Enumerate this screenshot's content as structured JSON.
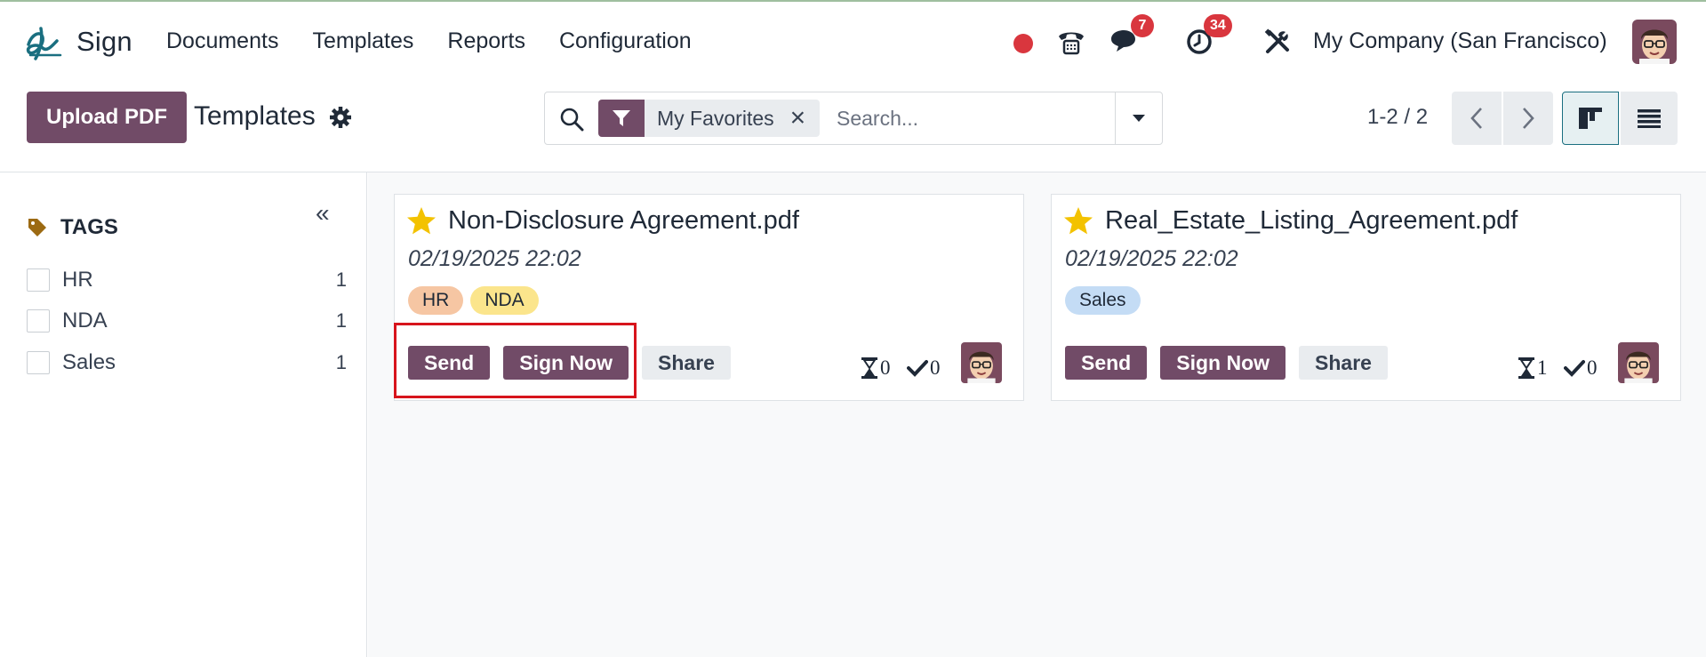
{
  "app": {
    "name": "Sign"
  },
  "nav": {
    "items": [
      "Documents",
      "Templates",
      "Reports",
      "Configuration"
    ]
  },
  "systray": {
    "messages_badge": "7",
    "activities_badge": "34",
    "company": "My Company (San Francisco)"
  },
  "control": {
    "upload_label": "Upload PDF",
    "title": "Templates",
    "facet_label": "My Favorites",
    "search_placeholder": "Search...",
    "pager": "1-2 / 2"
  },
  "sidebar": {
    "tags_title": "TAGS",
    "tags": [
      {
        "label": "HR",
        "count": "1"
      },
      {
        "label": "NDA",
        "count": "1"
      },
      {
        "label": "Sales",
        "count": "1"
      }
    ]
  },
  "cards": [
    {
      "title": "Non-Disclosure Agreement.pdf",
      "date": "02/19/2025 22:02",
      "tags": [
        "HR",
        "NDA"
      ],
      "actions": [
        "Send",
        "Sign Now",
        "Share"
      ],
      "pending": "0",
      "signed": "0"
    },
    {
      "title": "Real_Estate_Listing_Agreement.pdf",
      "date": "02/19/2025 22:02",
      "tags": [
        "Sales"
      ],
      "actions": [
        "Send",
        "Sign Now",
        "Share"
      ],
      "pending": "1",
      "signed": "0"
    }
  ],
  "colors": {
    "brand": "#714b67",
    "badge": "#d9363e",
    "tag_hr": "#f6c6a3",
    "tag_nda": "#fbe58c",
    "tag_sales": "#c4dcf5",
    "star": "#f3c200",
    "highlight": "#d7141c"
  },
  "icons": [
    "sign-logo-icon",
    "record-dot-icon",
    "phone-icon",
    "chat-icon",
    "clock-icon",
    "tools-icon",
    "gear-icon",
    "search-icon",
    "filter-icon",
    "close-icon",
    "caret-down-icon",
    "chevron-left-icon",
    "chevron-right-icon",
    "kanban-view-icon",
    "list-view-icon",
    "double-chevron-left-icon",
    "tag-icon",
    "star-icon",
    "hourglass-icon",
    "check-icon"
  ]
}
